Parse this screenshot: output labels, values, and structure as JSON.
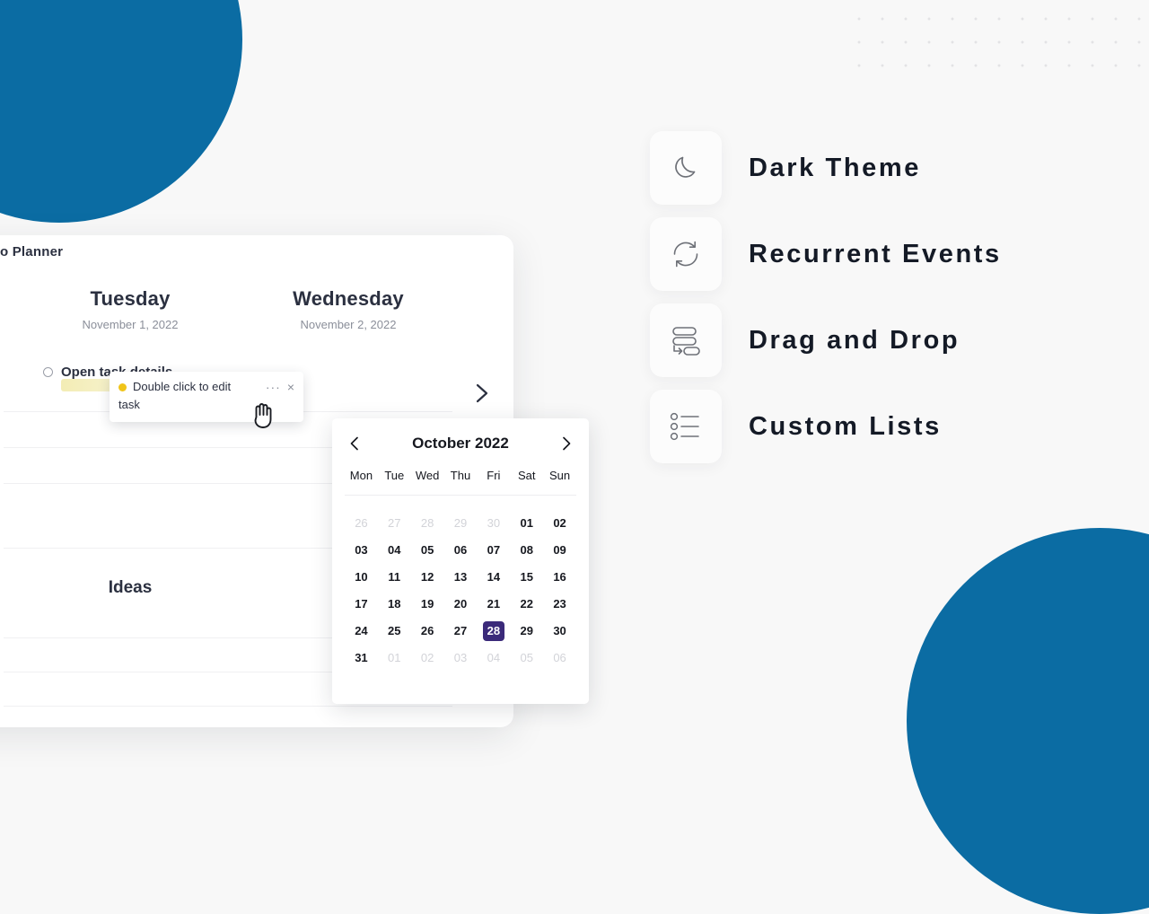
{
  "background": {
    "page_color": "#f8f8f8",
    "accent_blue": "#0b6ca3",
    "dot_grid_color": "#e2e2e4"
  },
  "planner": {
    "title": "o Planner",
    "days": [
      {
        "name": "Tuesday",
        "date": "November 1, 2022"
      },
      {
        "name": "Wednesday",
        "date": "November 2, 2022"
      }
    ],
    "task_row_label": "Open task details",
    "ideas_title": "Ideas",
    "next_arrow_icon": "chevron-right-icon"
  },
  "task_card": {
    "dot_color": "#f0c419",
    "text_line1": "Double click to edit",
    "text_line2": "task",
    "more_label": "···",
    "close_label": "×"
  },
  "calendar": {
    "month_title": "October 2022",
    "prev_icon": "chevron-left-icon",
    "next_icon": "chevron-right-icon",
    "weekdays": [
      "Mon",
      "Tue",
      "Wed",
      "Thu",
      "Fri",
      "Sat",
      "Sun"
    ],
    "selected_day": "28",
    "selected_color": "#3b2a7a",
    "weeks": [
      [
        {
          "label": "26",
          "muted": true
        },
        {
          "label": "27",
          "muted": true
        },
        {
          "label": "28",
          "muted": true
        },
        {
          "label": "29",
          "muted": true
        },
        {
          "label": "30",
          "muted": true
        },
        {
          "label": "01",
          "muted": false
        },
        {
          "label": "02",
          "muted": false
        }
      ],
      [
        {
          "label": "03",
          "muted": false
        },
        {
          "label": "04",
          "muted": false
        },
        {
          "label": "05",
          "muted": false
        },
        {
          "label": "06",
          "muted": false
        },
        {
          "label": "07",
          "muted": false
        },
        {
          "label": "08",
          "muted": false
        },
        {
          "label": "09",
          "muted": false
        }
      ],
      [
        {
          "label": "10",
          "muted": false
        },
        {
          "label": "11",
          "muted": false
        },
        {
          "label": "12",
          "muted": false
        },
        {
          "label": "13",
          "muted": false
        },
        {
          "label": "14",
          "muted": false
        },
        {
          "label": "15",
          "muted": false
        },
        {
          "label": "16",
          "muted": false
        }
      ],
      [
        {
          "label": "17",
          "muted": false
        },
        {
          "label": "18",
          "muted": false
        },
        {
          "label": "19",
          "muted": false
        },
        {
          "label": "20",
          "muted": false
        },
        {
          "label": "21",
          "muted": false
        },
        {
          "label": "22",
          "muted": false
        },
        {
          "label": "23",
          "muted": false
        }
      ],
      [
        {
          "label": "24",
          "muted": false
        },
        {
          "label": "25",
          "muted": false
        },
        {
          "label": "26",
          "muted": false
        },
        {
          "label": "27",
          "muted": false
        },
        {
          "label": "28",
          "muted": false,
          "selected": true
        },
        {
          "label": "29",
          "muted": false
        },
        {
          "label": "30",
          "muted": false
        }
      ],
      [
        {
          "label": "31",
          "muted": false
        },
        {
          "label": "01",
          "muted": true
        },
        {
          "label": "02",
          "muted": true
        },
        {
          "label": "03",
          "muted": true
        },
        {
          "label": "04",
          "muted": true
        },
        {
          "label": "05",
          "muted": true
        },
        {
          "label": "06",
          "muted": true
        }
      ]
    ]
  },
  "features": [
    {
      "label": "Dark Theme",
      "icon": "moon-icon"
    },
    {
      "label": "Recurrent Events",
      "icon": "refresh-cycle-icon"
    },
    {
      "label": "Drag and Drop",
      "icon": "drag-drop-icon"
    },
    {
      "label": "Custom Lists",
      "icon": "bullet-list-icon"
    }
  ]
}
